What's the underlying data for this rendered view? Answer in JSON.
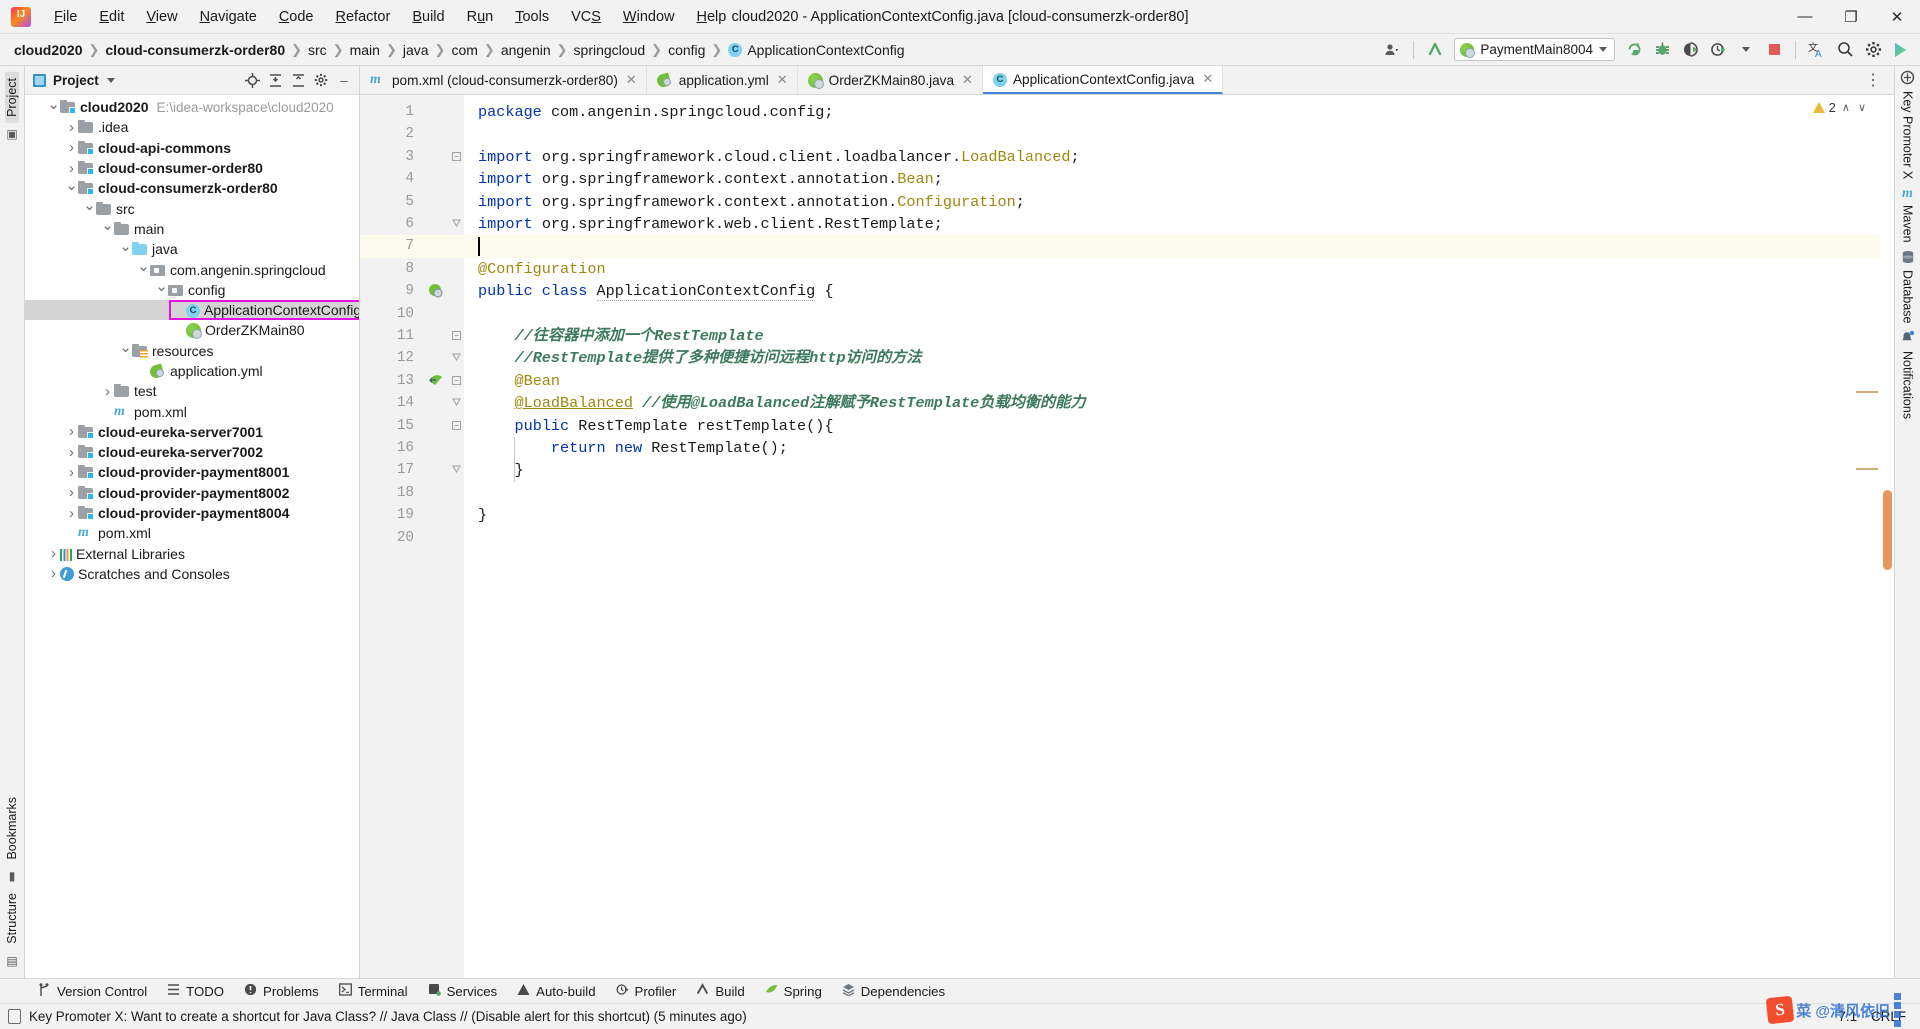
{
  "window": {
    "title": "cloud2020 - ApplicationContextConfig.java [cloud-consumerzk-order80]",
    "minimize": "—",
    "maximize": "❐",
    "close": "✕"
  },
  "menu": [
    {
      "label": "File"
    },
    {
      "label": "Edit"
    },
    {
      "label": "View"
    },
    {
      "label": "Navigate"
    },
    {
      "label": "Code"
    },
    {
      "label": "Refactor"
    },
    {
      "label": "Build"
    },
    {
      "label": "Run"
    },
    {
      "label": "Tools"
    },
    {
      "label": "VCS"
    },
    {
      "label": "Window"
    },
    {
      "label": "Help"
    }
  ],
  "breadcrumbs": [
    {
      "label": "cloud2020",
      "bold": true
    },
    {
      "label": "cloud-consumerzk-order80",
      "bold": true
    },
    {
      "label": "src",
      "bold": false
    },
    {
      "label": "main",
      "bold": false
    },
    {
      "label": "java",
      "bold": false
    },
    {
      "label": "com",
      "bold": false
    },
    {
      "label": "angenin",
      "bold": false
    },
    {
      "label": "springcloud",
      "bold": false
    },
    {
      "label": "config",
      "bold": false
    },
    {
      "label": "ApplicationContextConfig",
      "bold": false
    }
  ],
  "toolbar": {
    "run_config": "PaymentMain8004",
    "icons": [
      "account-icon",
      "chevron-down-icon",
      "update-project-icon",
      "rerun-icon",
      "debug-icon",
      "run-with-coverage-icon",
      "profiler-icon",
      "stop-icon",
      "translate-icon",
      "search-everywhere-icon",
      "settings-icon",
      "ide-services-icon"
    ]
  },
  "project_panel": {
    "title": "Project",
    "header_icons": [
      "locate-icon",
      "expand-all-icon",
      "collapse-all-icon",
      "settings-icon",
      "hide-icon"
    ],
    "tree": [
      {
        "depth": 0,
        "arrow": "down",
        "icon": "module-folder",
        "label": "cloud2020",
        "bold": true,
        "path": "E:\\idea-workspace\\cloud2020"
      },
      {
        "depth": 1,
        "arrow": "right",
        "icon": "folder",
        "label": ".idea",
        "bold": false
      },
      {
        "depth": 1,
        "arrow": "right",
        "icon": "module-folder",
        "label": "cloud-api-commons",
        "bold": true
      },
      {
        "depth": 1,
        "arrow": "right",
        "icon": "module-folder",
        "label": "cloud-consumer-order80",
        "bold": true
      },
      {
        "depth": 1,
        "arrow": "down",
        "icon": "module-folder",
        "label": "cloud-consumerzk-order80",
        "bold": true
      },
      {
        "depth": 2,
        "arrow": "down",
        "icon": "folder",
        "label": "src",
        "bold": false
      },
      {
        "depth": 3,
        "arrow": "down",
        "icon": "folder",
        "label": "main",
        "bold": false
      },
      {
        "depth": 4,
        "arrow": "down",
        "icon": "source-folder",
        "label": "java",
        "bold": false
      },
      {
        "depth": 5,
        "arrow": "down",
        "icon": "package",
        "label": "com.angenin.springcloud",
        "bold": false
      },
      {
        "depth": 6,
        "arrow": "down",
        "icon": "package",
        "label": "config",
        "bold": false
      },
      {
        "depth": 7,
        "arrow": "none",
        "icon": "java-class",
        "label": "ApplicationContextConfig",
        "bold": false,
        "selected": true,
        "focused": true
      },
      {
        "depth": 7,
        "arrow": "none",
        "icon": "spring-class",
        "label": "OrderZKMain80",
        "bold": false
      },
      {
        "depth": 4,
        "arrow": "down",
        "icon": "resource-folder",
        "label": "resources",
        "bold": false
      },
      {
        "depth": 5,
        "arrow": "none",
        "icon": "spring-yml",
        "label": "application.yml",
        "bold": false
      },
      {
        "depth": 3,
        "arrow": "right",
        "icon": "folder",
        "label": "test",
        "bold": false
      },
      {
        "depth": 3,
        "arrow": "none",
        "icon": "maven",
        "label": "pom.xml",
        "bold": false
      },
      {
        "depth": 1,
        "arrow": "right",
        "icon": "module-folder",
        "label": "cloud-eureka-server7001",
        "bold": true
      },
      {
        "depth": 1,
        "arrow": "right",
        "icon": "module-folder",
        "label": "cloud-eureka-server7002",
        "bold": true
      },
      {
        "depth": 1,
        "arrow": "right",
        "icon": "module-folder",
        "label": "cloud-provider-payment8001",
        "bold": true
      },
      {
        "depth": 1,
        "arrow": "right",
        "icon": "module-folder",
        "label": "cloud-provider-payment8002",
        "bold": true
      },
      {
        "depth": 1,
        "arrow": "right",
        "icon": "module-folder",
        "label": "cloud-provider-payment8004",
        "bold": true
      },
      {
        "depth": 1,
        "arrow": "none",
        "icon": "maven",
        "label": "pom.xml",
        "bold": false
      },
      {
        "depth": 0,
        "arrow": "right",
        "icon": "libraries",
        "label": "External Libraries",
        "bold": false
      },
      {
        "depth": 0,
        "arrow": "right",
        "icon": "scratches",
        "label": "Scratches and Consoles",
        "bold": false
      }
    ]
  },
  "left_rail": {
    "top": [
      "Project"
    ],
    "bottom": [
      "Bookmarks",
      "Structure"
    ]
  },
  "right_rail": [
    {
      "label": "Key Promoter X",
      "icon": "key-promoter-icon"
    },
    {
      "label": "Maven",
      "icon": "maven-icon"
    },
    {
      "label": "Database",
      "icon": "database-icon"
    },
    {
      "label": "Notifications",
      "icon": "notifications-icon"
    }
  ],
  "editor_tabs": [
    {
      "label": "pom.xml (cloud-consumerzk-order80)",
      "icon": "maven-icon",
      "active": false,
      "closable": true
    },
    {
      "label": "application.yml",
      "icon": "spring-yml-icon",
      "active": false,
      "closable": true
    },
    {
      "label": "OrderZKMain80.java",
      "icon": "spring-class-icon",
      "active": false,
      "closable": true
    },
    {
      "label": "ApplicationContextConfig.java",
      "icon": "java-class-icon",
      "active": true,
      "closable": true
    }
  ],
  "inspection": {
    "warning_count": "2",
    "warning_icon": "warning-triangle-icon",
    "chevron_up": "∧",
    "chevron_down": "∨"
  },
  "code": {
    "caret_position": "7:1",
    "line_separator": "CRLF",
    "lines": [
      {
        "n": "1",
        "html": "<span class='kw'>package</span> <span class='pln'>com.angenin.springcloud.config;</span>"
      },
      {
        "n": "2",
        "html": ""
      },
      {
        "n": "3",
        "html": "<span class='kw'>import</span> <span class='pln'>org.springframework.cloud.client.loadbalancer.</span><span class='ann'>LoadBalanced</span><span class='pln'>;</span>",
        "fold": "minus"
      },
      {
        "n": "4",
        "html": "<span class='kw'>import</span> <span class='pln'>org.springframework.context.annotation.</span><span class='ann'>Bean</span><span class='pln'>;</span>"
      },
      {
        "n": "5",
        "html": "<span class='kw'>import</span> <span class='pln'>org.springframework.context.annotation.</span><span class='ann'>Configuration</span><span class='pln'>;</span>"
      },
      {
        "n": "6",
        "html": "<span class='kw'>import</span> <span class='pln'>org.springframework.web.client.RestTemplate;</span>",
        "fold": "end"
      },
      {
        "n": "7",
        "html": "",
        "highlight": true,
        "caret": true
      },
      {
        "n": "8",
        "html": "<span class='ann'>@Configuration</span>"
      },
      {
        "n": "9",
        "html": "<span class='kw'>public class</span> <span class='cls wavy'>ApplicationContextConfig</span> <span class='pln'>{</span>",
        "glyph": "spring-bean-icon"
      },
      {
        "n": "10",
        "html": ""
      },
      {
        "n": "11",
        "html": "    <span class='cmt'>//往容器中添加一个RestTemplate</span>",
        "fold": "minus"
      },
      {
        "n": "12",
        "html": "    <span class='cmt'>//RestTemplate提供了多种便捷访问远程http访问的方法</span>",
        "fold": "end"
      },
      {
        "n": "13",
        "html": "    <span class='ann'>@Bean</span>",
        "glyph": "bean-nav-icon",
        "fold": "minus"
      },
      {
        "n": "14",
        "html": "    <span class='ann und'>@LoadBalanced</span> <span class='cmt'>//使用@LoadBalanced注解赋予RestTemplate负载均衡的能力</span>",
        "fold": "end"
      },
      {
        "n": "15",
        "html": "    <span class='kw'>public</span> <span class='cls'>RestTemplate</span> <span class='pln'>restTemplate(){</span>",
        "fold": "minus"
      },
      {
        "n": "16",
        "html": "        <span class='kw'>return new</span> <span class='pln'>RestTemplate();</span>"
      },
      {
        "n": "17",
        "html": "    <span class='pln'>}</span>",
        "fold": "end"
      },
      {
        "n": "18",
        "html": ""
      },
      {
        "n": "19",
        "html": "<span class='pln'>}</span>"
      },
      {
        "n": "20",
        "html": ""
      }
    ]
  },
  "bottom_tools": [
    {
      "label": "Version Control",
      "icon": "branch-icon"
    },
    {
      "label": "TODO",
      "icon": "todo-icon"
    },
    {
      "label": "Problems",
      "icon": "problems-icon"
    },
    {
      "label": "Terminal",
      "icon": "terminal-icon"
    },
    {
      "label": "Services",
      "icon": "services-icon"
    },
    {
      "label": "Auto-build",
      "icon": "auto-build-icon"
    },
    {
      "label": "Profiler",
      "icon": "profiler-icon"
    },
    {
      "label": "Build",
      "icon": "build-icon"
    },
    {
      "label": "Spring",
      "icon": "spring-icon"
    },
    {
      "label": "Dependencies",
      "icon": "dependencies-icon"
    }
  ],
  "status_bar": {
    "message": "Key Promoter X: Want to create a shortcut for Java Class? // Java Class // (Disable alert for this shortcut) (5 minutes ago)",
    "message_icon": "notification-icon",
    "caret": "7:1",
    "encoding_sep": "CRLF"
  },
  "watermark": {
    "logo": "S",
    "text": "菜 @清风依旧"
  },
  "colors": {
    "accent_blue": "#3d87d6",
    "keyword": "#0033b3",
    "comment": "#3d7a5d",
    "annotation": "#9e880d",
    "selection_outline": "#e213e2",
    "panel_bg": "#f2f2f2"
  }
}
